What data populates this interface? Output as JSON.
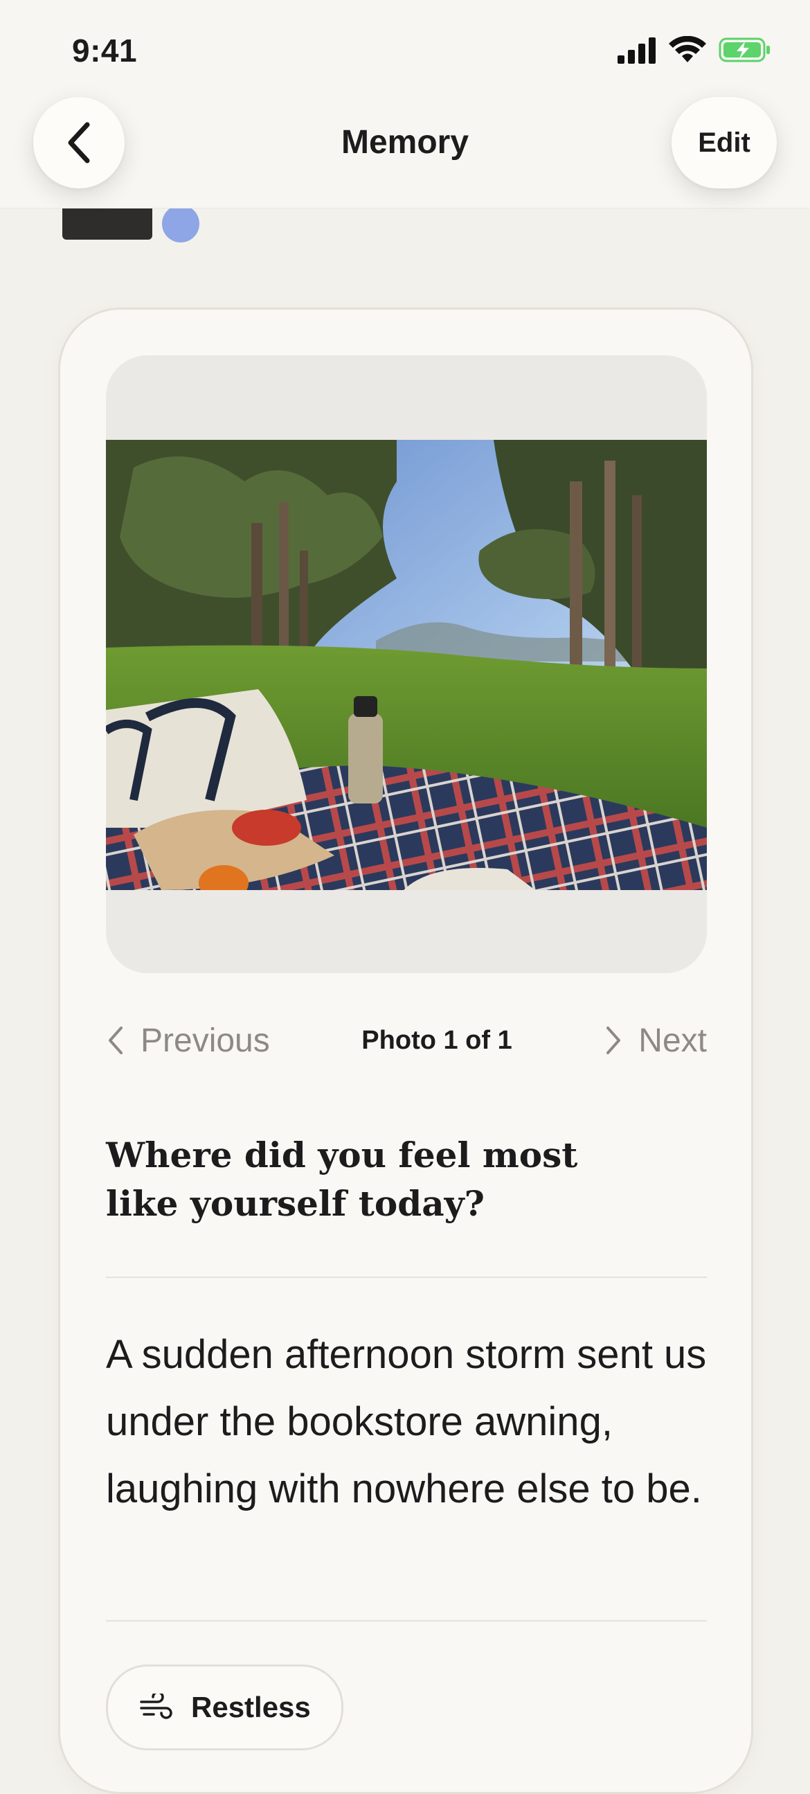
{
  "status_bar": {
    "time": "9:41",
    "battery_color": "#5cd36b"
  },
  "header": {
    "title": "Memory",
    "edit_label": "Edit",
    "back_icon": "chevron-left-icon"
  },
  "avatar": {
    "dot_color": "#8ea5e6"
  },
  "photo": {
    "alt": "Picnic blanket with a tote bag and water bottle on a sunny park lawn"
  },
  "pager": {
    "previous_label": "Previous",
    "count_label": "Photo 1 of 1",
    "next_label": "Next"
  },
  "prompt": {
    "question": "Where did you feel most like yourself today?"
  },
  "entry": {
    "text": "A sudden afternoon storm sent us under the bookstore awning, laughing with nowhere else to be."
  },
  "mood": {
    "label": "Restless",
    "icon": "wind-icon"
  }
}
